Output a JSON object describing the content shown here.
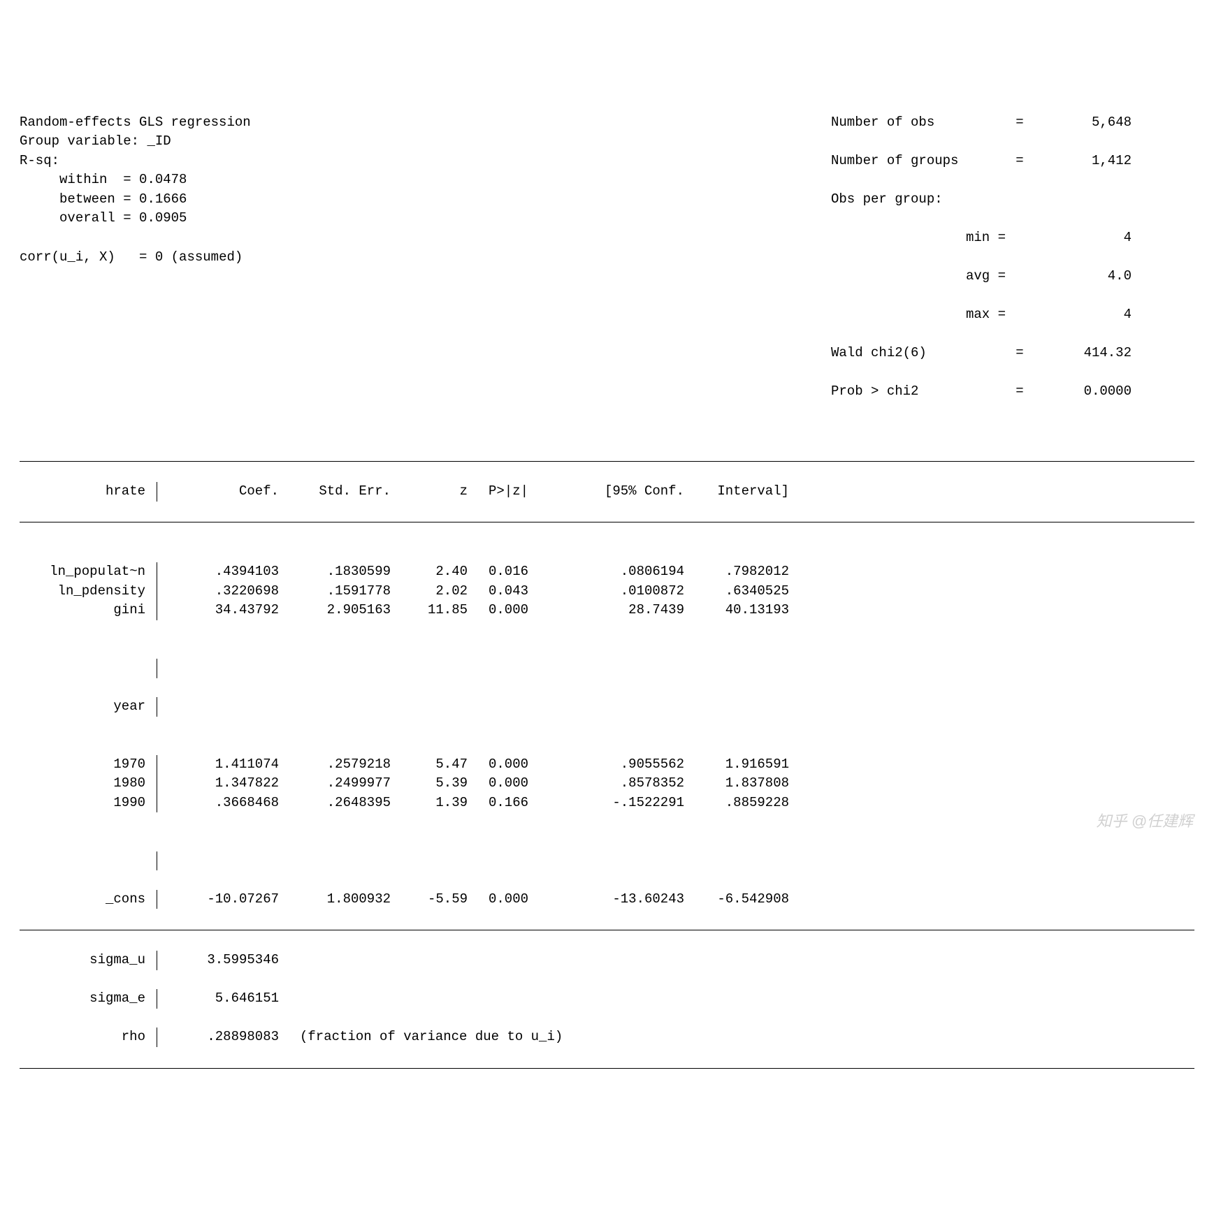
{
  "header": {
    "title": "Random-effects GLS regression",
    "group_var_label": "Group variable:",
    "group_var": "_ID",
    "rsq_label": "R-sq:",
    "rsq": {
      "within_label": "within  =",
      "within": "0.0478",
      "between_label": "between =",
      "between": "0.1666",
      "overall_label": "overall =",
      "overall": "0.0905"
    },
    "corr_label": "corr(u_i, X)",
    "corr_value": "= 0 (assumed)",
    "right": {
      "nobs_label": "Number of obs",
      "nobs": "5,648",
      "ngroups_label": "Number of groups",
      "ngroups": "1,412",
      "opg_label": "Obs per group:",
      "min_label": "min =",
      "min": "4",
      "avg_label": "avg =",
      "avg": "4.0",
      "max_label": "max =",
      "max": "4",
      "wald_label": "Wald chi2(6)",
      "wald": "414.32",
      "prob_label": "Prob > chi2",
      "prob": "0.0000"
    }
  },
  "table": {
    "depvar": "hrate",
    "cols": {
      "coef": "Coef.",
      "se": "Std. Err.",
      "z": "z",
      "p": "P>|z|",
      "cilo": "[95% Conf.",
      "cihi": "Interval]"
    },
    "rows": [
      {
        "name": "ln_populat~n",
        "coef": ".4394103",
        "se": ".1830599",
        "z": "2.40",
        "p": "0.016",
        "lo": ".0806194",
        "hi": ".7982012"
      },
      {
        "name": "ln_pdensity",
        "coef": ".3220698",
        "se": ".1591778",
        "z": "2.02",
        "p": "0.043",
        "lo": ".0100872",
        "hi": ".6340525"
      },
      {
        "name": "gini",
        "coef": "34.43792",
        "se": "2.905163",
        "z": "11.85",
        "p": "0.000",
        "lo": "28.7439",
        "hi": "40.13193"
      }
    ],
    "yearhdr": "year",
    "year_rows": [
      {
        "name": "1970",
        "coef": "1.411074",
        "se": ".2579218",
        "z": "5.47",
        "p": "0.000",
        "lo": ".9055562",
        "hi": "1.916591"
      },
      {
        "name": "1980",
        "coef": "1.347822",
        "se": ".2499977",
        "z": "5.39",
        "p": "0.000",
        "lo": ".8578352",
        "hi": "1.837808"
      },
      {
        "name": "1990",
        "coef": ".3668468",
        "se": ".2648395",
        "z": "1.39",
        "p": "0.166",
        "lo": "-.1522291",
        "hi": ".8859228"
      }
    ],
    "cons": {
      "name": "_cons",
      "coef": "-10.07267",
      "se": "1.800932",
      "z": "-5.59",
      "p": "0.000",
      "lo": "-13.60243",
      "hi": "-6.542908"
    },
    "footer": {
      "sigma_u_label": "sigma_u",
      "sigma_u": "3.5995346",
      "sigma_e_label": "sigma_e",
      "sigma_e": "5.646151",
      "rho_label": "rho",
      "rho": ".28898083",
      "rho_note": "(fraction of variance due to u_i)"
    }
  },
  "watermark": "知乎 @任建辉",
  "chart_data": {
    "type": "table",
    "title": "Random-effects GLS regression",
    "depvar": "hrate",
    "n_obs": 5648,
    "n_groups": 1412,
    "obs_per_group": {
      "min": 4,
      "avg": 4.0,
      "max": 4
    },
    "r_sq": {
      "within": 0.0478,
      "between": 0.1666,
      "overall": 0.0905
    },
    "wald_chi2_df": 6,
    "wald_chi2": 414.32,
    "prob_gt_chi2": 0.0,
    "corr_ui_X": 0,
    "coefficients": [
      {
        "var": "ln_populat~n",
        "coef": 0.4394103,
        "se": 0.1830599,
        "z": 2.4,
        "p": 0.016,
        "ci95": [
          0.0806194,
          0.7982012
        ]
      },
      {
        "var": "ln_pdensity",
        "coef": 0.3220698,
        "se": 0.1591778,
        "z": 2.02,
        "p": 0.043,
        "ci95": [
          0.0100872,
          0.6340525
        ]
      },
      {
        "var": "gini",
        "coef": 34.43792,
        "se": 2.905163,
        "z": 11.85,
        "p": 0.0,
        "ci95": [
          28.7439,
          40.13193
        ]
      },
      {
        "var": "year=1970",
        "coef": 1.411074,
        "se": 0.2579218,
        "z": 5.47,
        "p": 0.0,
        "ci95": [
          0.9055562,
          1.916591
        ]
      },
      {
        "var": "year=1980",
        "coef": 1.347822,
        "se": 0.2499977,
        "z": 5.39,
        "p": 0.0,
        "ci95": [
          0.8578352,
          1.837808
        ]
      },
      {
        "var": "year=1990",
        "coef": 0.3668468,
        "se": 0.2648395,
        "z": 1.39,
        "p": 0.166,
        "ci95": [
          -0.1522291,
          0.8859228
        ]
      },
      {
        "var": "_cons",
        "coef": -10.07267,
        "se": 1.800932,
        "z": -5.59,
        "p": 0.0,
        "ci95": [
          -13.60243,
          -6.542908
        ]
      }
    ],
    "sigma_u": 3.5995346,
    "sigma_e": 5.646151,
    "rho": 0.28898083
  }
}
